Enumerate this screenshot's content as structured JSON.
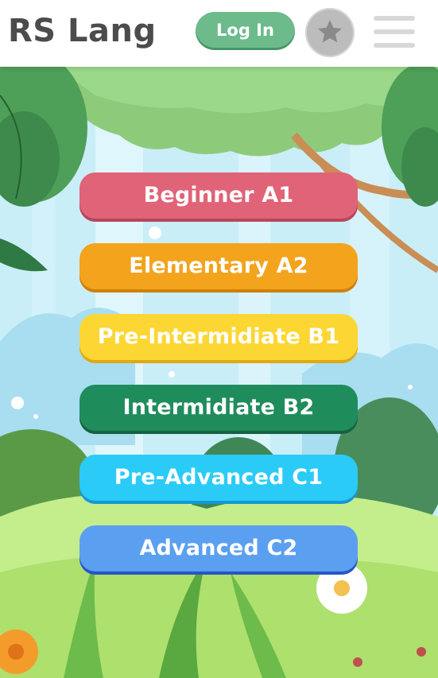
{
  "header": {
    "logo": "RS Lang",
    "login_label": "Log In",
    "star_icon": "star-icon",
    "menu_icon": "hamburger-menu-icon"
  },
  "levels": [
    {
      "label": "Beginner A1",
      "color": "#e06377",
      "shadow": "#b8465a"
    },
    {
      "label": "Elementary A2",
      "color": "#f3a31c",
      "shadow": "#d07f0c"
    },
    {
      "label": "Pre-Intermidiate B1",
      "color": "#fcd733",
      "shadow": "#e0a914"
    },
    {
      "label": "Intermidiate B2",
      "color": "#1f8c5c",
      "shadow": "#156243"
    },
    {
      "label": "Pre-Advanced C1",
      "color": "#2bcbf8",
      "shadow": "#1598d4"
    },
    {
      "label": "Advanced C2",
      "color": "#5b9ff0",
      "shadow": "#2855c8"
    }
  ],
  "colors": {
    "header_bg": "#ffffff",
    "login_bg": "#6dbb8b",
    "sky": "#c8ecf6"
  }
}
